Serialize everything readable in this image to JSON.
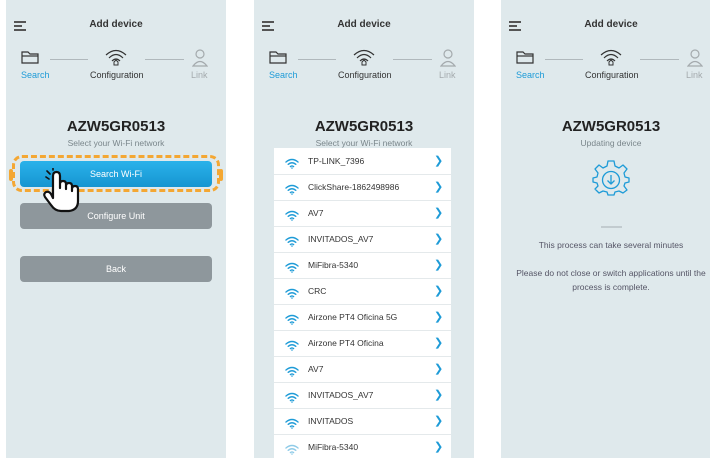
{
  "header": {
    "title": "Add device"
  },
  "steps": {
    "search": "Search",
    "configuration": "Configuration",
    "link": "Link"
  },
  "device": {
    "name": "AZW5GR0513"
  },
  "screen1": {
    "subtitle": "Select your Wi-Fi network",
    "search_wifi_label": "Search Wi-Fi",
    "configure_unit_label": "Configure Unit",
    "back_label": "Back"
  },
  "screen2": {
    "subtitle": "Select your Wi-Fi network",
    "networks": [
      "TP-LINK_7396",
      "ClickShare-1862498986",
      "AV7",
      "INVITADOS_AV7",
      "MiFibra-5340",
      "CRC",
      "Airzone PT4 Oficina 5G",
      "Airzone PT4 Oficina",
      "AV7",
      "INVITADOS_AV7",
      "INVITADOS",
      "MiFibra-5340"
    ]
  },
  "screen3": {
    "subtitle": "Updating device",
    "info1": "This process can take several minutes",
    "info2": "Please do not close or switch applications until the process is complete."
  },
  "colors": {
    "accent": "#1e9bd7",
    "highlight": "#f4a733",
    "button_gray": "#8e979c",
    "background": "#dfe9ec"
  },
  "icons": [
    "menu-icon",
    "folder-icon",
    "router-wifi-icon",
    "user-icon",
    "wifi-icon",
    "chevron-right-icon",
    "gear-download-icon",
    "pointing-hand-icon"
  ]
}
